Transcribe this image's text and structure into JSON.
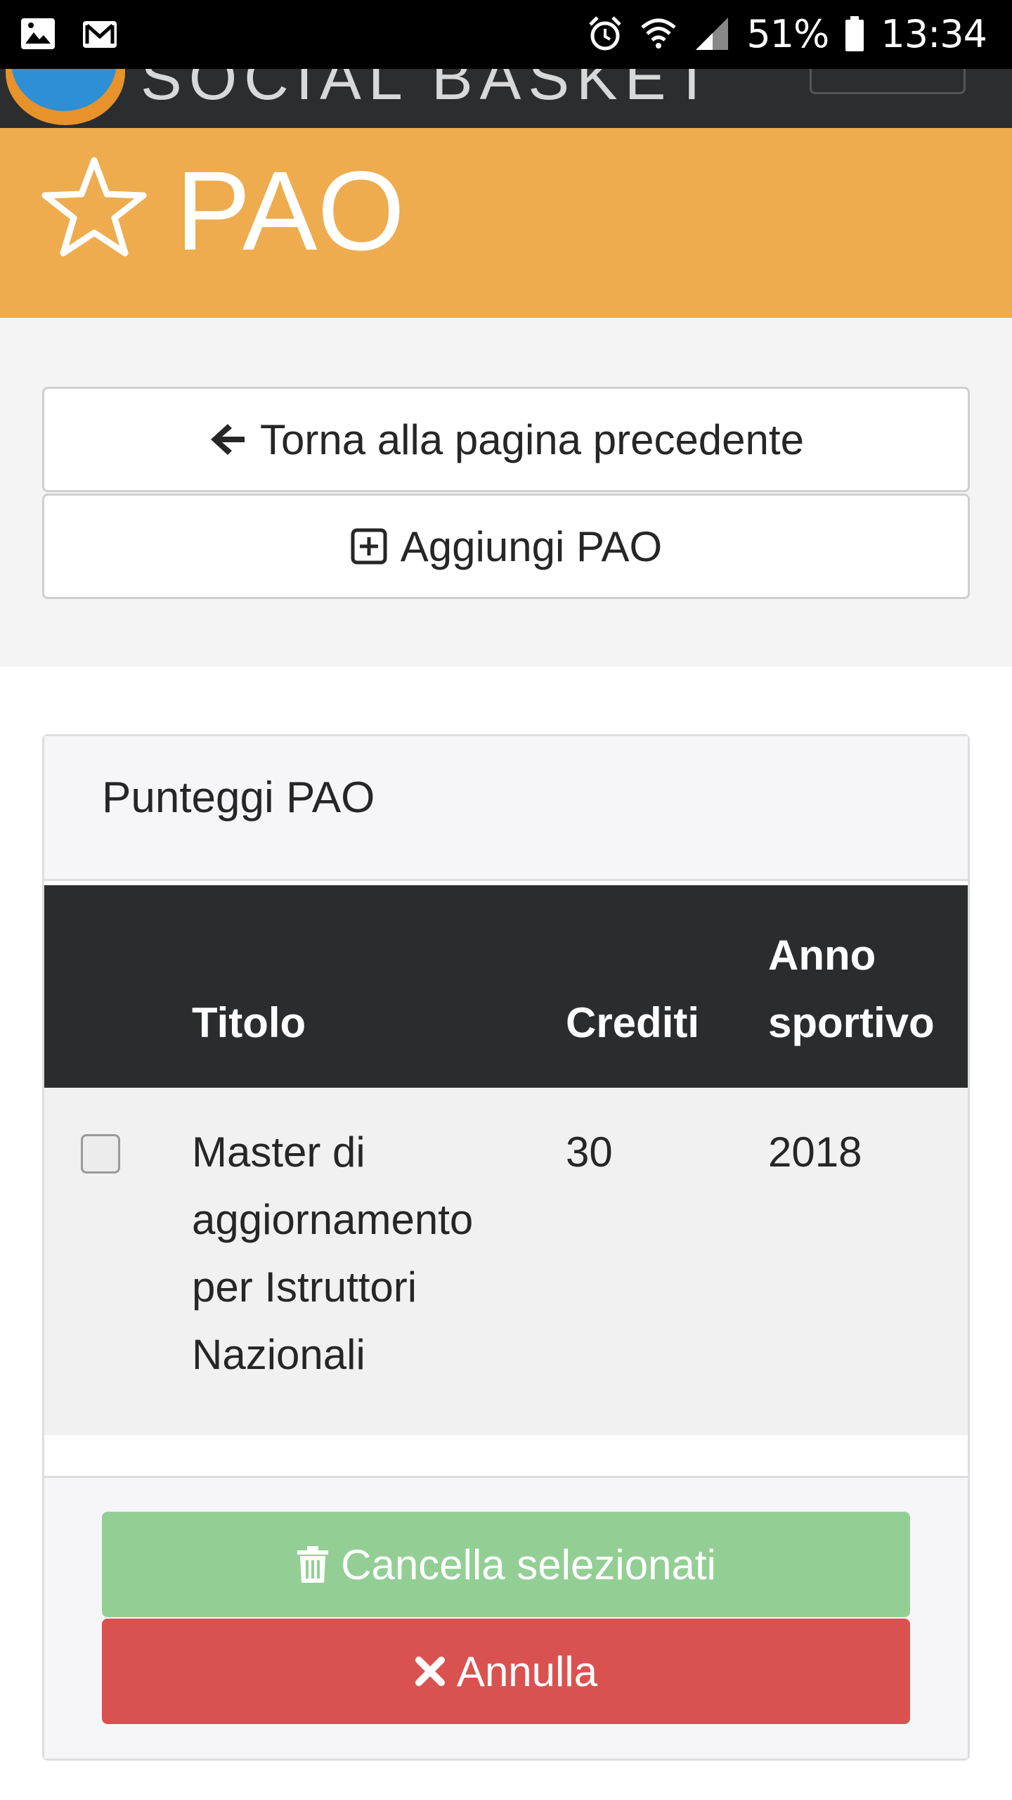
{
  "status_bar": {
    "battery": "51%",
    "time": "13:34",
    "icons": [
      "image-icon",
      "gmail-icon",
      "alarm-icon",
      "wifi-icon",
      "signal-icon",
      "battery-icon"
    ]
  },
  "header": {
    "title": "PAO",
    "icon": "star-icon",
    "accent": "#eeac4e"
  },
  "actions": {
    "back_label": "Torna alla pagina precedente",
    "add_label": "Aggiungi PAO"
  },
  "panel": {
    "title": "Punteggi PAO",
    "columns": [
      "",
      "Titolo",
      "Crediti",
      "Anno sportivo"
    ],
    "column_lines": {
      "anno_line1": "Anno",
      "anno_line2": "sportivo"
    },
    "rows": [
      {
        "checked": false,
        "titolo_lines": [
          "Master di",
          "aggiornamento",
          "per Istruttori",
          "Nazionali"
        ],
        "crediti": "30",
        "anno": "2018"
      }
    ],
    "delete_label": "Cancella selezionati",
    "cancel_label": "Annulla",
    "colors": {
      "delete": "#93cf95",
      "cancel": "#da5250",
      "table_header": "#2b2c2e"
    }
  }
}
